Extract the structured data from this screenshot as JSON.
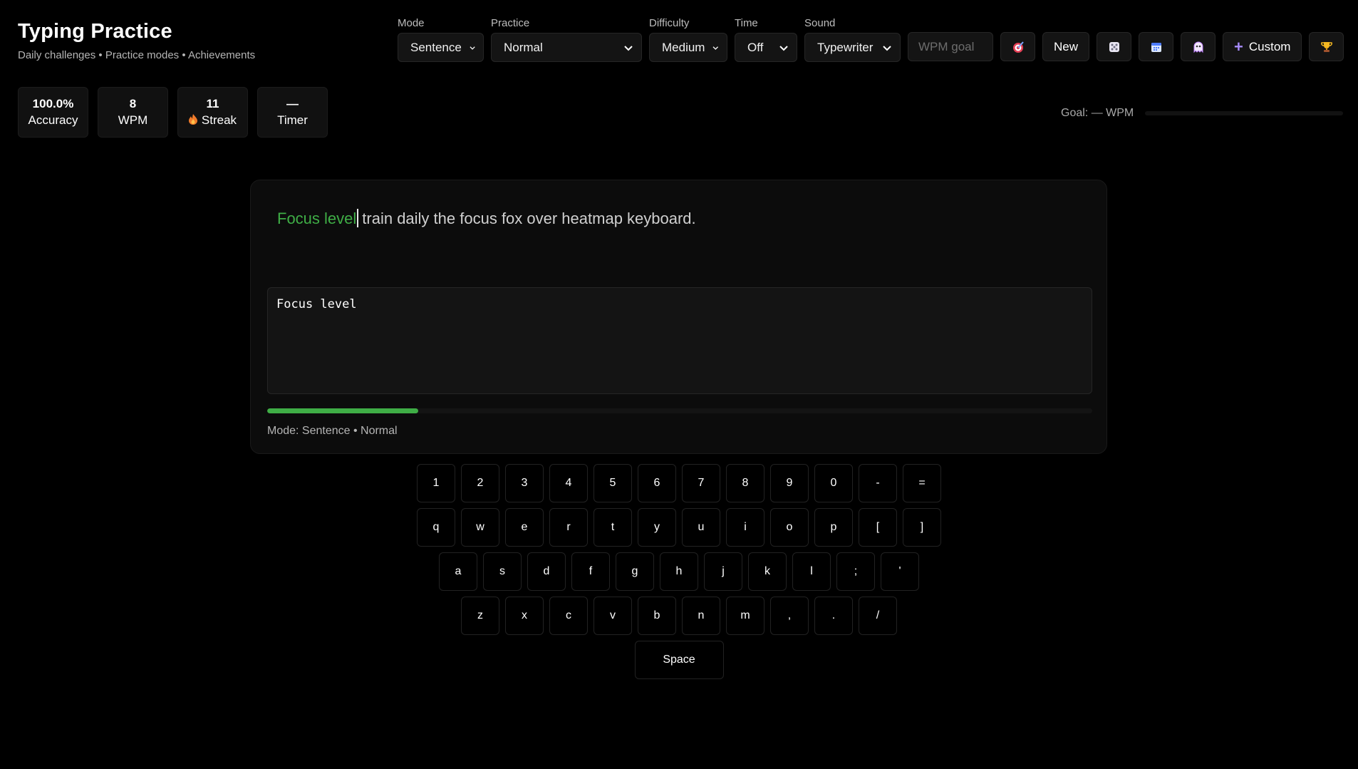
{
  "app": {
    "title": "Typing Practice",
    "subtitle": "Daily challenges • Practice modes • Achievements"
  },
  "controls": {
    "mode": {
      "label": "Mode",
      "value": "Sentence"
    },
    "practice": {
      "label": "Practice",
      "value": "Normal"
    },
    "difficulty": {
      "label": "Difficulty",
      "value": "Medium"
    },
    "time": {
      "label": "Time",
      "value": "Off"
    },
    "sound": {
      "label": "Sound",
      "value": "Typewriter"
    },
    "wpm_goal_placeholder": "WPM goal",
    "new_label": "New",
    "custom_label": "Custom",
    "icons": [
      "target-icon",
      "dice-icon",
      "calendar-icon",
      "ghost-icon",
      "trophy-icon"
    ]
  },
  "stats": {
    "accuracy": {
      "value": "100.0%",
      "label": "Accuracy"
    },
    "wpm": {
      "value": "8",
      "label": "WPM"
    },
    "streak": {
      "value": "11",
      "label": "Streak"
    },
    "timer": {
      "value": "—",
      "label": "Timer"
    }
  },
  "goal": {
    "text": "Goal: — WPM",
    "progress": 0
  },
  "practice": {
    "typed_text": "Focus level",
    "remaining_text": "train daily the focus fox over heatmap keyboard.",
    "input_value": "Focus level",
    "progress_percent": 18.3,
    "status": "Mode: Sentence • Normal"
  },
  "keyboard": {
    "rows": [
      [
        "1",
        "2",
        "3",
        "4",
        "5",
        "6",
        "7",
        "8",
        "9",
        "0",
        "-",
        "="
      ],
      [
        "q",
        "w",
        "e",
        "r",
        "t",
        "y",
        "u",
        "i",
        "o",
        "p",
        "[",
        "]"
      ],
      [
        "a",
        "s",
        "d",
        "f",
        "g",
        "h",
        "j",
        "k",
        "l",
        ";",
        "'"
      ],
      [
        "z",
        "x",
        "c",
        "v",
        "b",
        "n",
        "m",
        ",",
        ".",
        "/"
      ]
    ],
    "space_label": "Space"
  },
  "colors": {
    "background": "#000000",
    "accent_green": "#3fae46",
    "custom_plus": "#a78bfa"
  }
}
